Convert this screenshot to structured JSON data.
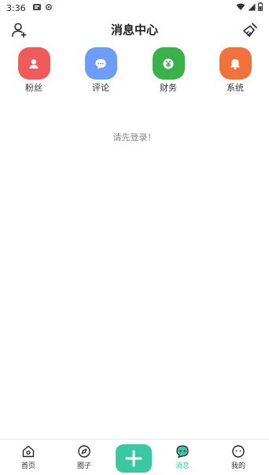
{
  "status_bar": {
    "time": "3:36"
  },
  "header": {
    "title": "消息中心"
  },
  "categories": [
    {
      "label": "粉丝",
      "color": "#ef5a5a"
    },
    {
      "label": "评论",
      "color": "#6f9cf6"
    },
    {
      "label": "财务",
      "color": "#3bb14a"
    },
    {
      "label": "系统",
      "color": "#f2723c"
    }
  ],
  "empty_message": "请先登录！",
  "tabbar": {
    "home": "首页",
    "circle": "圈子",
    "messages": "消息",
    "mine": "我的"
  },
  "colors": {
    "accent": "#3cc7a3"
  }
}
